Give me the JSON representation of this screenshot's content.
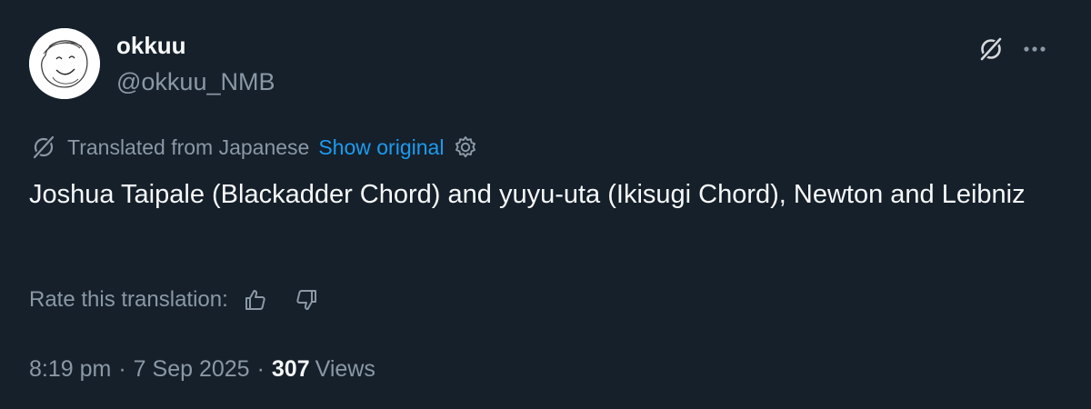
{
  "author": {
    "display_name": "okkuu",
    "handle": "@okkuu_NMB",
    "avatar_icon": "smiley-sketch-avatar"
  },
  "header_actions": {
    "grok_icon": "grok-icon",
    "more_icon": "more-icon"
  },
  "translation": {
    "icon": "grok-icon",
    "label": "Translated from Japanese",
    "show_original": "Show original",
    "settings_icon": "gear-icon"
  },
  "tweet": {
    "text": "Joshua Taipale (Blackadder Chord) and yuyu-uta (Ikisugi Chord), Newton and Leibniz"
  },
  "rating": {
    "label": "Rate this translation:",
    "thumbs_up_icon": "thumbs-up-icon",
    "thumbs_down_icon": "thumbs-down-icon"
  },
  "meta": {
    "time": "8:19 pm",
    "separator": "·",
    "date": "7 Sep 2025",
    "views_count": "307",
    "views_label": "Views"
  },
  "colors": {
    "background": "#15202b",
    "text_primary": "#f7f9f9",
    "text_secondary": "#8b98a5",
    "link": "#1d9bf0"
  }
}
